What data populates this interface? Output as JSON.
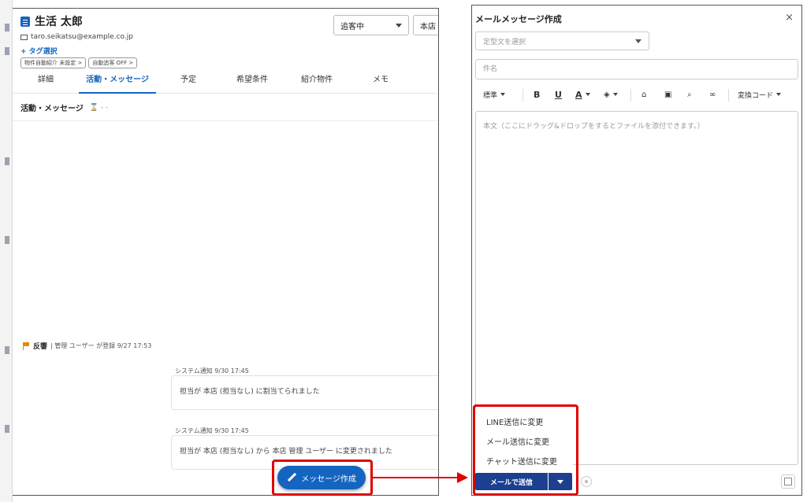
{
  "customer": {
    "name": "生活 太郎",
    "email": "taro.seikatsu@example.co.jp",
    "tag_add": "+ タグ選択",
    "chips": [
      "物件自動紹介 未設定 >",
      "自動追客 OFF >"
    ]
  },
  "header": {
    "status": "追客中",
    "branch": "本店"
  },
  "tabs": [
    "詳細",
    "活動・メッセージ",
    "予定",
    "希望条件",
    "紹介物件",
    "メモ"
  ],
  "active_tab": "活動・メッセージ",
  "section": {
    "title": "活動・メッセージ",
    "icon_text": "⌛ - -"
  },
  "timeline": {
    "response_label": "反響",
    "response_detail": "| 管理 ユーザー が登録 9/27 17:53",
    "notices": [
      {
        "meta": "システム通知 9/30 17:45",
        "text": "担当が 本店 (担当なし) に割当てられました"
      },
      {
        "meta": "システム通知 9/30 17:45",
        "text": "担当が 本店 (担当なし) から 本店 管理 ユーザー に変更されました"
      }
    ]
  },
  "fab": {
    "label": "メッセージ作成"
  },
  "dialog": {
    "title": "メールメッセージ作成",
    "close": "×",
    "template_placeholder": "定型文を選択",
    "subject_placeholder": "件名",
    "body_placeholder": "本文（ここにドラッグ&ドロップをするとファイルを添付できます。）",
    "toolbar": {
      "style": "標準",
      "bold": "B",
      "underline": "U",
      "font_color": "A",
      "replace_code": "変換コード"
    },
    "menu_items": [
      "LINE送信に変更",
      "メール送信に変更",
      "チャット送信に変更"
    ],
    "send_label": "メールで送信"
  },
  "colors": {
    "primary": "#1565c0",
    "send_button": "#1c3f8f",
    "highlight": "#e00000",
    "flag": "#e6870b"
  },
  "icons": [
    "document-icon",
    "mail-icon",
    "caret-down-icon",
    "hourglass-icon",
    "flag-icon",
    "pencil-icon",
    "close-icon",
    "bold-icon",
    "underline-icon",
    "font-color-icon",
    "fill-color-icon",
    "home-icon",
    "image-icon",
    "attach-icon",
    "link-icon",
    "eye-icon",
    "save-icon"
  ]
}
